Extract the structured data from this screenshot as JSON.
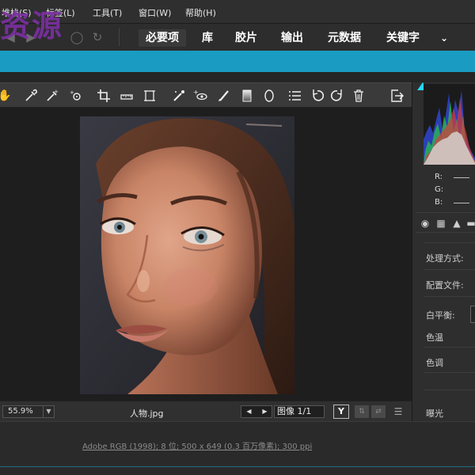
{
  "menu": [
    "堆栈(S)",
    "标签(L)",
    "工具(T)",
    "窗口(W)",
    "帮助(H)"
  ],
  "watermark": "资源",
  "workspace_tabs": [
    "必要项",
    "库",
    "胶片",
    "输出",
    "元数据",
    "关键字"
  ],
  "more_icon": "chevron-down-icon",
  "accent_color": "#1a9cc2",
  "tools": [
    "hand-icon",
    "eyedropper-icon",
    "color-sampler-icon",
    "target-adjust-icon",
    "crop-icon",
    "straighten-icon",
    "transform-icon",
    "spot-removal-icon",
    "red-eye-icon",
    "brush-icon",
    "graduated-filter-icon",
    "radial-filter-icon",
    "list-icon",
    "rotate-left-icon",
    "rotate-right-icon",
    "trash-icon",
    "open-image-icon"
  ],
  "status": {
    "zoom": "55.9%",
    "filename": "人物.jpg",
    "page": "图像 1/1",
    "y_button": "Y"
  },
  "panel": {
    "rgb": [
      "R:",
      "G:",
      "B:"
    ],
    "process_label": "处理方式:",
    "profile_label": "配置文件:",
    "wb_label": "白平衡:",
    "temp_label": "色温",
    "tint_label": "色调",
    "exposure_label": "曝光"
  },
  "image_info": "Adobe RGB (1998); 8 位; 500 x 649 (0.3 百万像素); 300 ppi"
}
